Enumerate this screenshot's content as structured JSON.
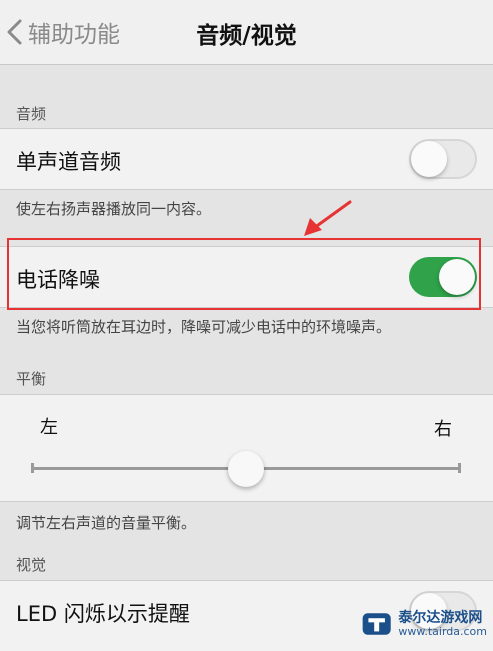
{
  "nav": {
    "back_label": "辅助功能",
    "title": "音频/视觉"
  },
  "audio": {
    "header": "音频",
    "mono": {
      "label": "单声道音频",
      "on": false,
      "footer": "使左右扬声器播放同一内容。"
    },
    "noise": {
      "label": "电话降噪",
      "on": true,
      "footer": "当您将听筒放在耳边时，降噪可减少电话中的环境噪声。"
    }
  },
  "balance": {
    "header": "平衡",
    "left_label": "左",
    "right_label": "右",
    "value": 0.5,
    "footer": "调节左右声道的音量平衡。"
  },
  "visual": {
    "header": "视觉",
    "led": {
      "label": "LED 闪烁以示提醒",
      "on": false
    }
  },
  "colors": {
    "switch_on": "#2fa24a",
    "highlight": "#e63333"
  },
  "watermark": {
    "name": "泰尔达游戏网",
    "url": "www.tairda.com"
  }
}
